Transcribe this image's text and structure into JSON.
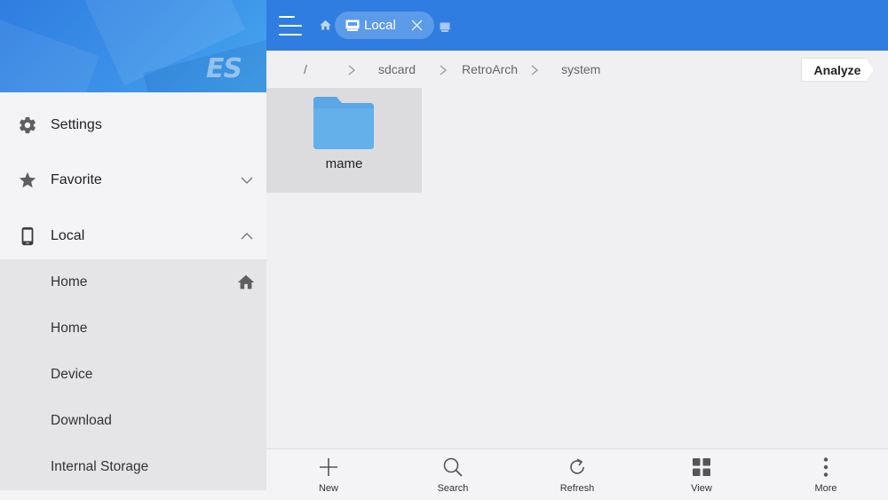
{
  "colors": {
    "accent": "#2f7de1",
    "sidebar_bg": "#f4f4f6",
    "submenu_bg": "#e5e5e7",
    "folder": "#5eade8",
    "selected_tile": "#dcdcde"
  },
  "sidebar": {
    "logo": "ES",
    "items": [
      {
        "label": "Settings",
        "icon": "gear-icon"
      },
      {
        "label": "Favorite",
        "icon": "star-icon",
        "expand": "chevron-down-icon"
      },
      {
        "label": "Local",
        "icon": "phone-icon",
        "expand": "chevron-up-icon"
      }
    ],
    "local_children": [
      {
        "label": "Home",
        "icon": "home-icon"
      },
      {
        "label": "Home"
      },
      {
        "label": "Device"
      },
      {
        "label": "Download"
      },
      {
        "label": "Internal Storage"
      }
    ]
  },
  "topbar": {
    "tab": {
      "label": "Local",
      "icon": "storage-icon"
    }
  },
  "pathbar": {
    "segments": [
      "/",
      "sdcard",
      "RetroArch",
      "system"
    ],
    "analyze_label": "Analyze"
  },
  "content": {
    "files": [
      {
        "name": "mame",
        "type": "folder"
      }
    ]
  },
  "toolbar": {
    "items": [
      {
        "label": "New",
        "icon": "plus-icon"
      },
      {
        "label": "Search",
        "icon": "search-icon"
      },
      {
        "label": "Refresh",
        "icon": "refresh-icon"
      },
      {
        "label": "View",
        "icon": "grid-view-icon"
      },
      {
        "label": "More",
        "icon": "more-vertical-icon"
      }
    ]
  }
}
